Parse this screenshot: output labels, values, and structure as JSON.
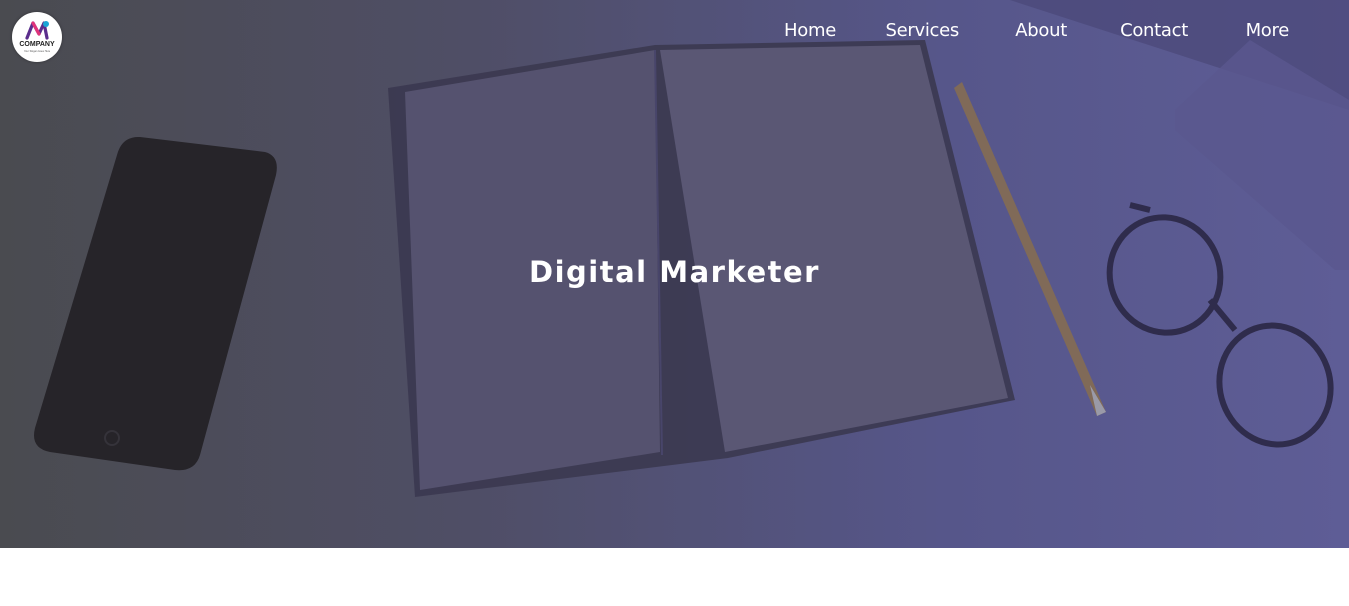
{
  "brand": {
    "name": "COMPANY",
    "tagline": "Your Slogan Goes Here"
  },
  "nav": {
    "items": [
      "Home",
      "Services",
      "About",
      "Contact",
      "More"
    ]
  },
  "hero": {
    "title": "Digital Marketer"
  },
  "colors": {
    "overlay_left": "#4a4b50",
    "overlay_right": "#5e5d96",
    "text": "#ffffff"
  }
}
